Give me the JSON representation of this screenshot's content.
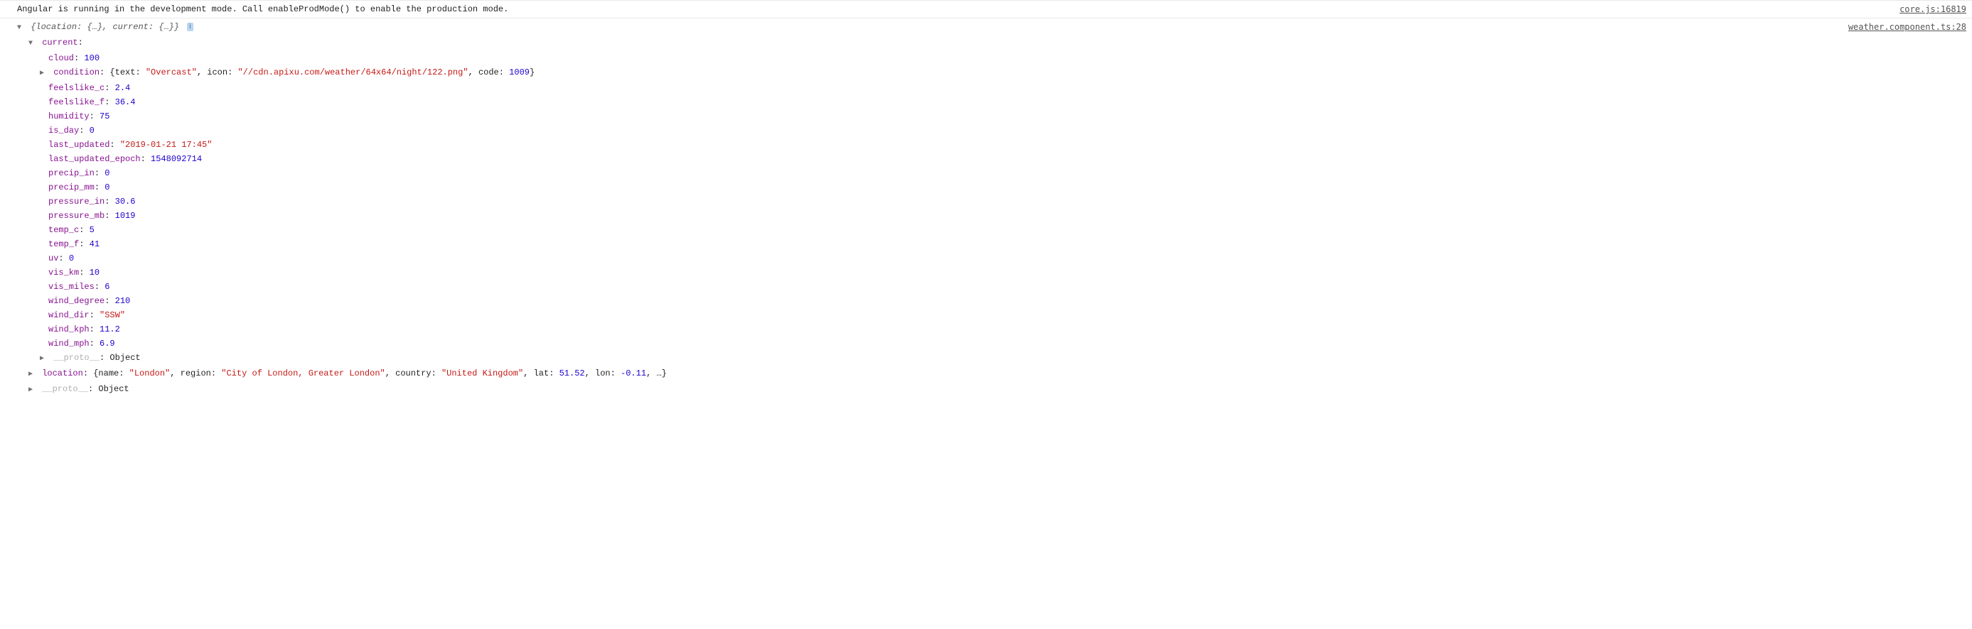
{
  "msg1": {
    "text": "Angular is running in the development mode. Call enableProdMode() to enable the production mode.",
    "source": "core.js:16819"
  },
  "msg2": {
    "summary_pre": "{",
    "summary_k1": "location",
    "summary_v1": "{…}",
    "summary_sep": ", ",
    "summary_k2": "current",
    "summary_v2": "{…}",
    "summary_post": "}",
    "info_badge": "i",
    "source": "weather.component.ts:28"
  },
  "current_label": "current",
  "current": {
    "cloud": {
      "k": "cloud",
      "v": "100"
    },
    "condition": {
      "k": "condition",
      "pre": "{",
      "text_k": "text",
      "text_v": "\"Overcast\"",
      "sep1": ", ",
      "icon_k": "icon",
      "icon_v": "\"//cdn.apixu.com/weather/64x64/night/122.png\"",
      "sep2": ", ",
      "code_k": "code",
      "code_v": "1009",
      "post": "}"
    },
    "feelslike_c": {
      "k": "feelslike_c",
      "v": "2.4"
    },
    "feelslike_f": {
      "k": "feelslike_f",
      "v": "36.4"
    },
    "humidity": {
      "k": "humidity",
      "v": "75"
    },
    "is_day": {
      "k": "is_day",
      "v": "0"
    },
    "last_updated": {
      "k": "last_updated",
      "v": "\"2019-01-21 17:45\""
    },
    "last_updated_epoch": {
      "k": "last_updated_epoch",
      "v": "1548092714"
    },
    "precip_in": {
      "k": "precip_in",
      "v": "0"
    },
    "precip_mm": {
      "k": "precip_mm",
      "v": "0"
    },
    "pressure_in": {
      "k": "pressure_in",
      "v": "30.6"
    },
    "pressure_mb": {
      "k": "pressure_mb",
      "v": "1019"
    },
    "temp_c": {
      "k": "temp_c",
      "v": "5"
    },
    "temp_f": {
      "k": "temp_f",
      "v": "41"
    },
    "uv": {
      "k": "uv",
      "v": "0"
    },
    "vis_km": {
      "k": "vis_km",
      "v": "10"
    },
    "vis_miles": {
      "k": "vis_miles",
      "v": "6"
    },
    "wind_degree": {
      "k": "wind_degree",
      "v": "210"
    },
    "wind_dir": {
      "k": "wind_dir",
      "v": "\"SSW\""
    },
    "wind_kph": {
      "k": "wind_kph",
      "v": "11.2"
    },
    "wind_mph": {
      "k": "wind_mph",
      "v": "6.9"
    },
    "proto": {
      "k": "__proto__",
      "v": "Object"
    }
  },
  "location_row": {
    "k": "location",
    "pre": "{",
    "name_k": "name",
    "name_v": "\"London\"",
    "sep1": ", ",
    "region_k": "region",
    "region_v": "\"City of London, Greater London\"",
    "sep2": ", ",
    "country_k": "country",
    "country_v": "\"United Kingdom\"",
    "sep3": ", ",
    "lat_k": "lat",
    "lat_v": "51.52",
    "sep4": ", ",
    "lon_k": "lon",
    "lon_v": "-0.11",
    "sep5": ", ",
    "ellipsis": "…",
    "post": "}"
  },
  "root_proto": {
    "k": "__proto__",
    "v": "Object"
  }
}
